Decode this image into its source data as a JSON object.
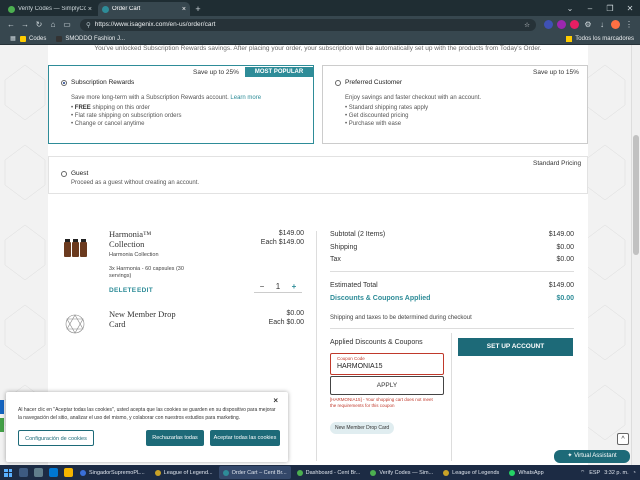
{
  "browser": {
    "tabs": [
      {
        "title": "Verify Codes — SimplyCodes",
        "color": "#4caf50",
        "active": false
      },
      {
        "title": "Order Cart",
        "color": "#2e8c98",
        "active": true
      }
    ],
    "url": "https://www.isagenix.com/en-us/order/cart",
    "bookmarks": [
      {
        "label": "Codes",
        "color": "#ffcc00"
      },
      {
        "label": "SMODDO Fashion J...",
        "color": "#333333"
      }
    ],
    "bookmarks_right": "Todos los marcadores"
  },
  "page": {
    "notice": "You've unlocked Subscription Rewards savings. After placing your order, your subscription will be automatically set up with the products from Today's Order.",
    "plans": {
      "subscription": {
        "title": "Subscription Rewards",
        "save": "Save up to 25%",
        "badge": "MOST POPULAR",
        "desc": "Save more long-term with a Subscription Rewards account.",
        "link": "Learn more",
        "items_bold": "FREE",
        "item1_rest": "shipping on this order",
        "item2": "Flat rate shipping on subscription orders",
        "item3": "Change or cancel anytime"
      },
      "preferred": {
        "title": "Preferred Customer",
        "save": "Save up to 15%",
        "desc": "Enjoy savings and faster checkout with an account.",
        "item1": "Standard shipping rates apply",
        "item2": "Get discounted pricing",
        "item3": "Purchase with ease"
      },
      "guest": {
        "title": "Guest",
        "pricing": "Standard Pricing",
        "desc": "Proceed as a guest without creating an account."
      }
    },
    "cart": {
      "items": [
        {
          "name_line1": "Harmonia™",
          "name_line2": "Collection",
          "subtitle": "Harmonia Collection",
          "detail_line1": "3x Harmonia - 60 capsules (30",
          "detail_line2": "servings)",
          "price": "$149.00",
          "each": "Each $149.00",
          "delete": "DELETE",
          "edit": "EDIT",
          "qty": "1",
          "minus": "−",
          "plus": "+"
        },
        {
          "name_line1": "New Member Drop",
          "name_line2": "Card",
          "price": "$0.00",
          "each": "Each $0.00"
        }
      ],
      "summary": {
        "subtotal_label": "Subtotal (2 Items)",
        "subtotal": "$149.00",
        "shipping_label": "Shipping",
        "shipping": "$0.00",
        "tax_label": "Tax",
        "tax": "$0.00",
        "estimated_label": "Estimated Total",
        "estimated": "$149.00",
        "discounts_label": "Discounts & Coupons Applied",
        "discounts": "$0.00",
        "ship_note": "Shipping and taxes to be determined during checkout"
      },
      "coupons": {
        "title": "Applied Discounts & Coupons",
        "field_label": "Coupon Code",
        "value": "HARMONIA15",
        "apply": "APPLY",
        "error_line1": "[HARMONIA15] - Your shopping cart does not meet",
        "error_line2": "the requirements for this coupon",
        "chip": "New Member Drop Card"
      },
      "setup_account": "SET UP ACCOUNT"
    },
    "cookie": {
      "text": "Al hacer clic en \"Aceptar todas las cookies\", usted acepta que las cookies se guarden en su dispositivo para mejorar la navegación del sitio, analizar el uso del mismo, y colaborar con nuestros estudios para marketing.",
      "config": "Configuración de cookies",
      "reject": "Rechazarlas todas",
      "accept": "Aceptar todas las cookies",
      "close": "×"
    },
    "virtual_assistant": "Virtual Assistant",
    "back_to_top": "^"
  },
  "taskbar": {
    "items": [
      {
        "label": "SingadorSupremoPL...",
        "color": "#3a6fd8",
        "active": false
      },
      {
        "label": "League of Legend...",
        "color": "#c9a227",
        "active": false
      },
      {
        "label": "Order Cart – Cent Br...",
        "color": "#2e8c98",
        "active": true
      },
      {
        "label": "Dashboard - Cent Br...",
        "color": "#4caf50",
        "active": false
      },
      {
        "label": "Verify Codes — Sim...",
        "color": "#4caf50",
        "active": false
      },
      {
        "label": "League of Legends",
        "color": "#c9a227",
        "active": false
      },
      {
        "label": "WhatsApp",
        "color": "#25d366",
        "active": false
      }
    ],
    "lang": "ESP",
    "time": "3:32 p. m."
  }
}
